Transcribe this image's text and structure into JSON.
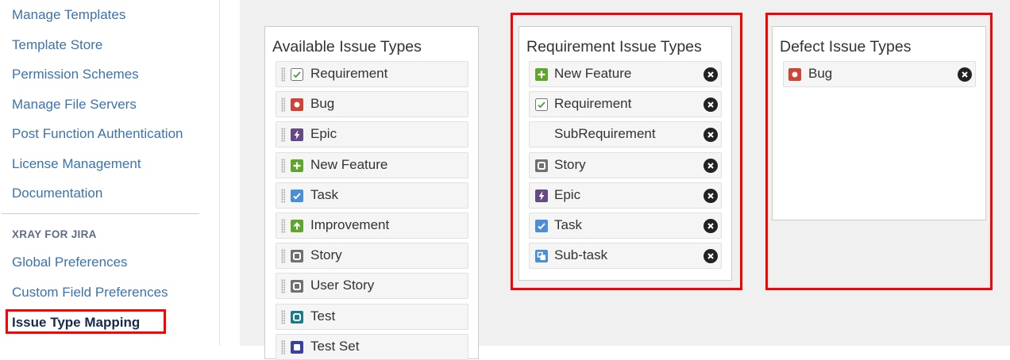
{
  "sidebar": {
    "links": [
      "Manage Templates",
      "Template Store",
      "Permission Schemes",
      "Manage File Servers",
      "Post Function Authentication",
      "License Management",
      "Documentation"
    ],
    "section_heading": "XRAY FOR JIRA",
    "section_links": [
      "Global Preferences",
      "Custom Field Preferences"
    ],
    "active_link": "Issue Type Mapping"
  },
  "available": {
    "title": "Available Issue Types",
    "items": [
      "Requirement",
      "Bug",
      "Epic",
      "New Feature",
      "Task",
      "Improvement",
      "Story",
      "User Story",
      "Test",
      "Test Set"
    ]
  },
  "requirement": {
    "title": "Requirement Issue Types",
    "items": [
      "New Feature",
      "Requirement",
      "SubRequirement",
      "Story",
      "Epic",
      "Task",
      "Sub-task"
    ]
  },
  "defect": {
    "title": "Defect Issue Types",
    "items": [
      "Bug"
    ]
  },
  "colors": {
    "link": "#3b73af",
    "highlight": "#ff0000",
    "bug": "#d04437",
    "epic": "#654982",
    "feature": "#5fa52e",
    "task": "#4a8fd5",
    "story": "#707070",
    "test": "#1b7a8c"
  }
}
